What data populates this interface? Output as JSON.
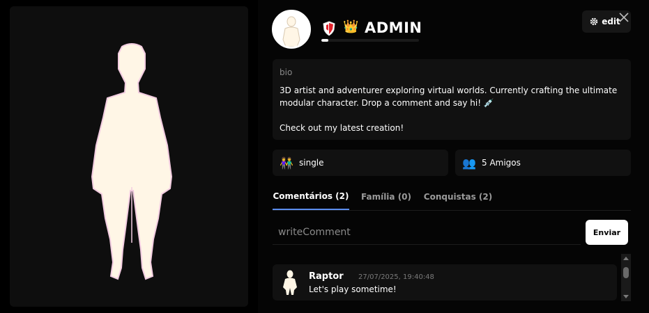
{
  "profile": {
    "username": "ADMIN",
    "xp_progress_fraction": 0.07,
    "badges": [
      {
        "icon": "shield-icon",
        "color": "#e0202a"
      },
      {
        "icon": "crown-icon",
        "glyph": "👑"
      }
    ]
  },
  "header": {
    "edit_label": "edit"
  },
  "bio": {
    "label": "bio",
    "text": "3D artist and adventurer exploring virtual worlds. Currently crafting the ultimate modular character. Drop a comment and say hi! 💉\n\nCheck out my latest creation!"
  },
  "stats": {
    "relationship": {
      "icon": "couple-icon",
      "glyph": "👫",
      "label": "single"
    },
    "friends": {
      "icon": "people-icon",
      "glyph": "👥",
      "label": "5 Amigos"
    }
  },
  "tabs": [
    {
      "label": "Comentários (2)",
      "active": true
    },
    {
      "label": "Família (0)",
      "active": false
    },
    {
      "label": "Conquistas (2)",
      "active": false
    }
  ],
  "comment_form": {
    "placeholder": "writeComment",
    "send_label": "Enviar"
  },
  "comments": [
    {
      "author": "Raptor",
      "timestamp": "27/07/2025, 19:40:48",
      "text": "Let's play sometime!"
    }
  ],
  "colors": {
    "accent": "#5b8def",
    "skin": "#fff6e6",
    "panel": "#111111",
    "shield_red": "#e0202a"
  }
}
